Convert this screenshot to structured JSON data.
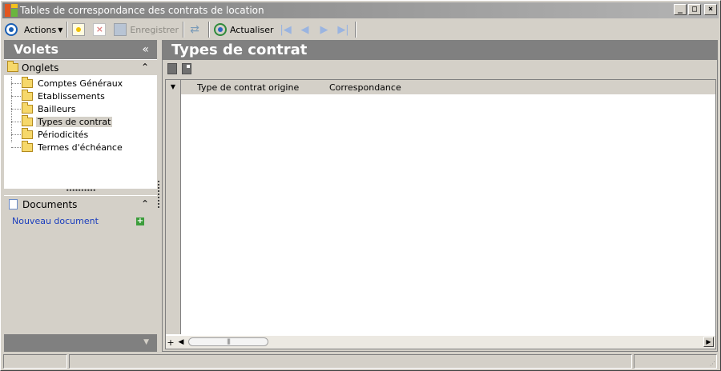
{
  "window": {
    "title": "Tables de correspondance des contrats de location",
    "buttons": [
      "minimize",
      "maximize",
      "close"
    ],
    "minimize_glyph": "_",
    "maximize_glyph": "□",
    "close_glyph": "×"
  },
  "toolbar": {
    "actions_label": "Actions",
    "save_label": "Enregistrer",
    "refresh_label": "Actualiser",
    "icons": [
      "actions-icon",
      "new-icon",
      "delete-icon",
      "save-icon",
      "sync-icon",
      "refresh-icon",
      "first-icon",
      "previous-icon",
      "next-icon",
      "last-icon"
    ],
    "nav": {
      "first": "|◀",
      "previous": "◀",
      "next": "▶",
      "last": "▶|"
    }
  },
  "left_pane": {
    "title": "Volets",
    "collapse_glyph": "«",
    "onglets": {
      "label": "Onglets",
      "items": [
        {
          "label": "Comptes Généraux"
        },
        {
          "label": "Etablissements"
        },
        {
          "label": "Bailleurs"
        },
        {
          "label": "Types de contrat",
          "selected": true
        },
        {
          "label": "Périodicités"
        },
        {
          "label": "Termes d'échéance"
        }
      ]
    },
    "documents": {
      "label": "Documents",
      "new_document_label": "Nouveau document"
    }
  },
  "right_pane": {
    "title": "Types de contrat",
    "columns": [
      "Type de contrat origine",
      "Correspondance"
    ],
    "rows": []
  },
  "colors": {
    "header_bg": "#808080",
    "window_bg": "#d4d0c8",
    "link": "#1a3dbd"
  }
}
